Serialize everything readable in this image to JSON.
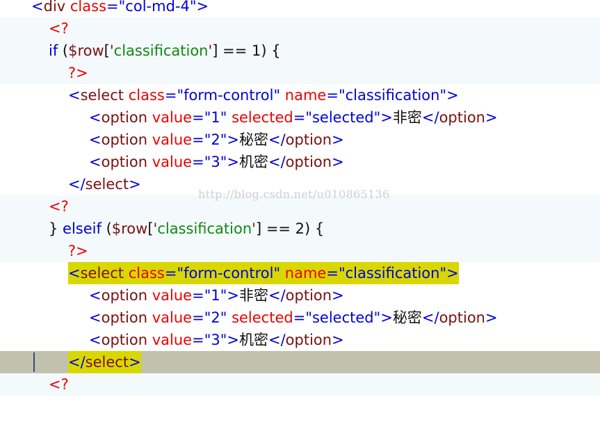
{
  "editor": {
    "lines": {
      "l0": {
        "lt": "<",
        "name": "div",
        "attr": "class",
        "eq": "=",
        "val": "\"col-md-4\"",
        "gt": ">"
      },
      "l1": {
        "text": "<?"
      },
      "l2": {
        "kw": "if",
        "p1": " (",
        "var": "$row",
        "b1": "[",
        "q1": "'",
        "s": "classification",
        "q2": "'",
        "b2": "]",
        "rest": " == 1) {"
      },
      "l3": {
        "text": "?>"
      },
      "l4": {
        "lt": "<",
        "name": "select",
        "a1": "class",
        "e1": "=",
        "v1": "\"form-control\"",
        "a2": "name",
        "e2": "=",
        "v2": "\"classification\"",
        "gt": ">"
      },
      "l5": {
        "lt": "<",
        "name": "option",
        "a1": "value",
        "e1": "=",
        "v1": "\"1\"",
        "a2": "selected",
        "e2": "=",
        "v2": "\"selected\"",
        "gt": ">",
        "content": "非密",
        "clt": "</",
        "cname": "option",
        "cgt": ">"
      },
      "l6": {
        "lt": "<",
        "name": "option",
        "a1": "value",
        "e1": "=",
        "v1": "\"2\"",
        "gt": ">",
        "content": "秘密",
        "clt": "</",
        "cname": "option",
        "cgt": ">"
      },
      "l7": {
        "lt": "<",
        "name": "option",
        "a1": "value",
        "e1": "=",
        "v1": "\"3\"",
        "gt": ">",
        "content": "机密",
        "clt": "</",
        "cname": "option",
        "cgt": ">"
      },
      "l8": {
        "clt": "</",
        "cname": "select",
        "cgt": ">"
      },
      "l9": {
        "text": "<?"
      },
      "l10": {
        "p0": "} ",
        "kw": "elseif",
        "p1": " (",
        "var": "$row",
        "b1": "[",
        "q1": "'",
        "s": "classification",
        "q2": "'",
        "b2": "]",
        "rest": " == 2) {"
      },
      "l11": {
        "text": "?>"
      },
      "l12": {
        "lt": "<",
        "name": "select",
        "a1": "class",
        "e1": "=",
        "v1": "\"form-control\"",
        "a2": "name",
        "e2": "=",
        "v2": "\"classification\"",
        "gt": ">"
      },
      "l13": {
        "lt": "<",
        "name": "option",
        "a1": "value",
        "e1": "=",
        "v1": "\"1\"",
        "gt": ">",
        "content": "非密",
        "clt": "</",
        "cname": "option",
        "cgt": ">"
      },
      "l14": {
        "lt": "<",
        "name": "option",
        "a1": "value",
        "e1": "=",
        "v1": "\"2\"",
        "a2": "selected",
        "e2": "=",
        "v2": "\"selected\"",
        "gt": ">",
        "content": "秘密",
        "clt": "</",
        "cname": "option",
        "cgt": ">"
      },
      "l15": {
        "lt": "<",
        "name": "option",
        "a1": "value",
        "e1": "=",
        "v1": "\"3\"",
        "gt": ">",
        "content": "机密",
        "clt": "</",
        "cname": "option",
        "cgt": ">"
      },
      "l16": {
        "clt": "</",
        "cname": "select",
        "cgt": ">"
      },
      "l17": {
        "text": "<?"
      }
    },
    "watermark": "http://blog.csdn.net/u010865136"
  }
}
